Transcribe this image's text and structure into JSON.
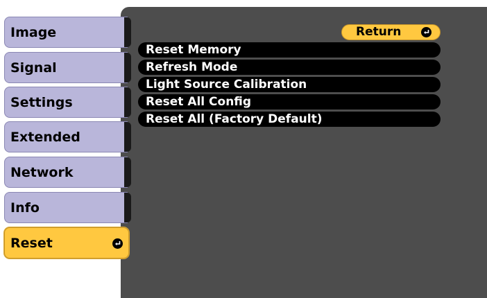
{
  "sidebar": {
    "tabs": [
      {
        "label": "Image"
      },
      {
        "label": "Signal"
      },
      {
        "label": "Settings"
      },
      {
        "label": "Extended"
      },
      {
        "label": "Network"
      },
      {
        "label": "Info"
      },
      {
        "label": "Reset",
        "active": true
      }
    ]
  },
  "main": {
    "return_label": "Return",
    "items": [
      {
        "label": "Reset Memory"
      },
      {
        "label": "Refresh Mode"
      },
      {
        "label": "Light Source Calibration"
      },
      {
        "label": "Reset All Config"
      },
      {
        "label": "Reset All (Factory Default)"
      }
    ]
  },
  "colors": {
    "panel": "#4d4d4d",
    "tab_inactive": "#b9b6da",
    "tab_active": "#ffc840",
    "row_background": "#000000",
    "row_text": "#ffffff"
  },
  "icons": {
    "enter": "enter-key-icon"
  }
}
